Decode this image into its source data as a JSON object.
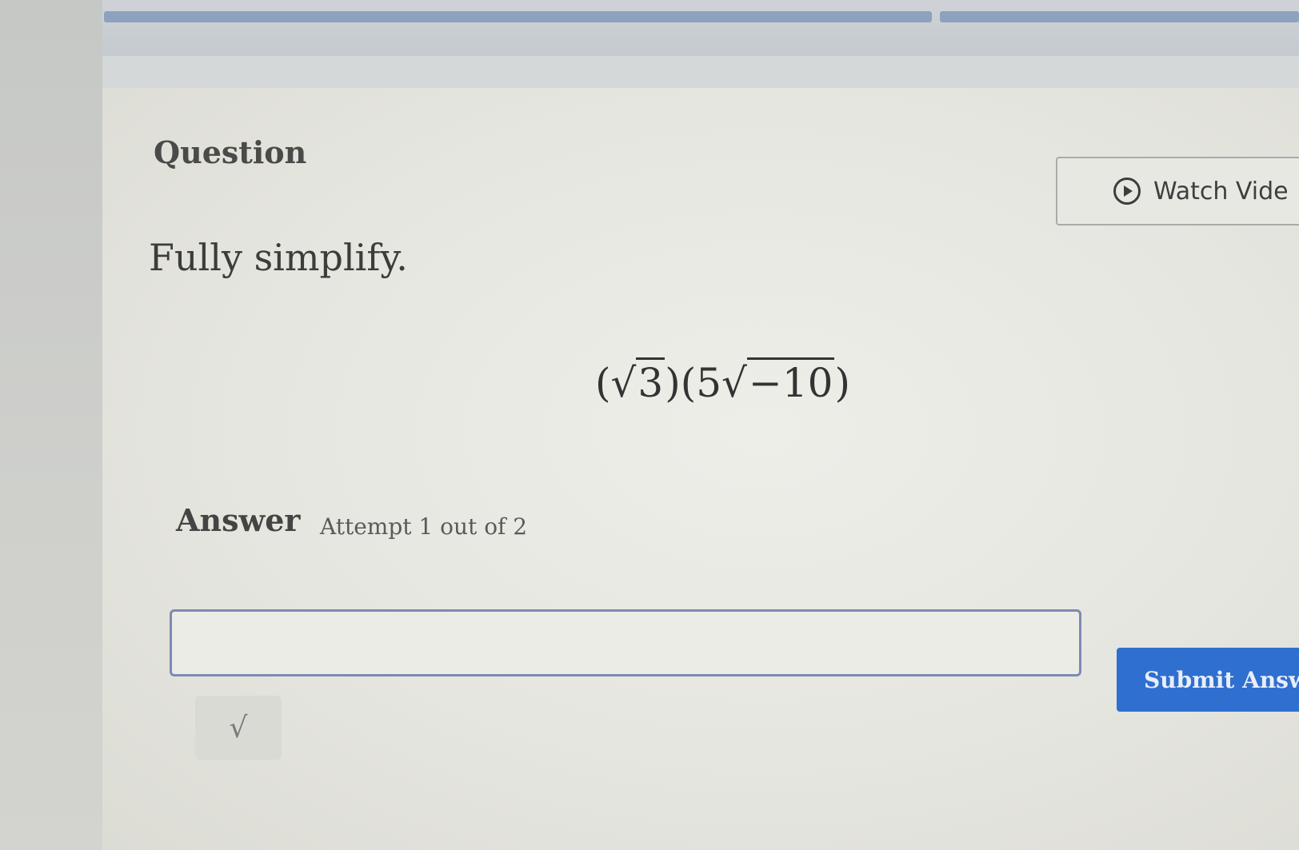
{
  "question": {
    "heading": "Question",
    "watch_video_label": "Watch Vide",
    "prompt": "Fully simplify.",
    "expression": {
      "open1": "(",
      "radicand1": "3",
      "close1": ")",
      "open2": "(",
      "coefficient": "5",
      "radicand2": "−10",
      "close2": ")"
    }
  },
  "answer": {
    "label": "Answer",
    "attempt": "Attempt 1 out of 2",
    "input_value": "",
    "submit_label": "Submit Answ",
    "sqrt_tool": "√"
  },
  "colors": {
    "accent": "#2f6fd0",
    "progress": "#8da2bf",
    "input_border": "#7d8ab4"
  }
}
